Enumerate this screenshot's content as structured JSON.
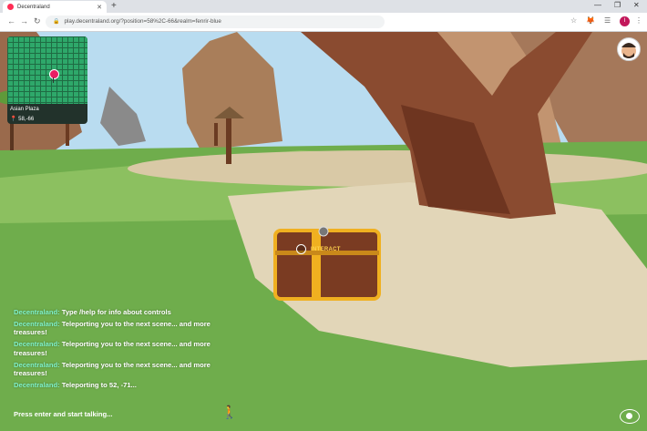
{
  "browser": {
    "tab_title": "Decentraland",
    "new_tab": "+",
    "url": "play.decentraland.org/?position=58%2C-66&realm=fenrir-blue",
    "user_initial": "I"
  },
  "minimap": {
    "place_name": "Asian Plaza",
    "coords": "58,-66"
  },
  "interact_label": "INTERACT",
  "chat": {
    "messages": [
      {
        "sender": "Decentraland:",
        "text": " Type /help for info about controls"
      },
      {
        "sender": "Decentraland:",
        "text": " Teleporting you to the next scene... and more treasures!"
      },
      {
        "sender": "Decentraland:",
        "text": " Teleporting you to the next scene... and more treasures!"
      },
      {
        "sender": "Decentraland:",
        "text": " Teleporting you to the next scene... and more treasures!"
      },
      {
        "sender": "Decentraland:",
        "text": " Teleporting to 52, -71..."
      }
    ],
    "input_prompt": "Press enter and start talking..."
  },
  "colors": {
    "accent_chat_sender": "#7ef0c8",
    "interact": "#ffd24d",
    "grass": "#6da94a",
    "sky": "#b9dcf0"
  }
}
